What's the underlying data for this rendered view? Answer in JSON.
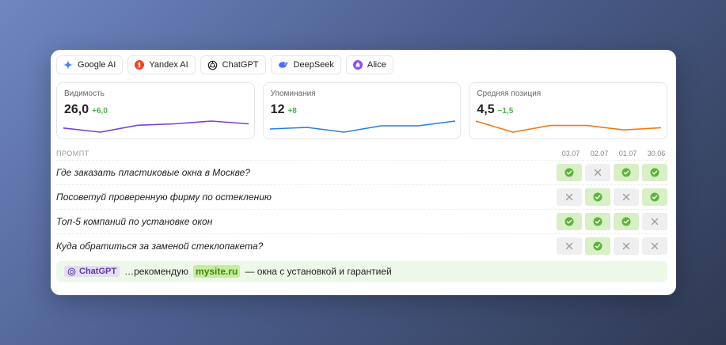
{
  "tabs": [
    {
      "label": "Google AI",
      "icon": "google-ai-icon"
    },
    {
      "label": "Yandex AI",
      "icon": "yandex-icon"
    },
    {
      "label": "ChatGPT",
      "icon": "chatgpt-icon"
    },
    {
      "label": "DeepSeek",
      "icon": "deepseek-icon"
    },
    {
      "label": "Alice",
      "icon": "alice-icon"
    }
  ],
  "stats": [
    {
      "label": "Видимость",
      "value": "26,0",
      "delta": "+6,0",
      "color": "#7b3fd6",
      "trend": [
        5,
        2,
        7,
        8,
        10,
        8
      ]
    },
    {
      "label": "Упоминания",
      "value": "12",
      "delta": "+8",
      "color": "#2a7de1",
      "trend": [
        4,
        5,
        2,
        6,
        6,
        9
      ]
    },
    {
      "label": "Средняя позиция",
      "value": "4,5",
      "delta": "−1,5",
      "color": "#f07a1a",
      "trend": [
        8,
        3,
        6,
        6,
        4,
        5
      ]
    }
  ],
  "table": {
    "header": "ПРОМПТ",
    "dates": [
      "03.07",
      "02.07",
      "01.07",
      "30.06"
    ],
    "rows": [
      {
        "prompt": "Где заказать пластиковые окна в Москве?",
        "marks": [
          true,
          false,
          true,
          true
        ]
      },
      {
        "prompt": "Посоветуй проверенную фирму по остеклению",
        "marks": [
          false,
          true,
          false,
          true
        ]
      },
      {
        "prompt": "Топ-5 компаний по установке окон",
        "marks": [
          true,
          true,
          true,
          false
        ]
      },
      {
        "prompt": "Куда обратиться за заменой стеклопакета?",
        "marks": [
          false,
          true,
          false,
          false
        ]
      }
    ]
  },
  "footer": {
    "source": "ChatGPT",
    "before": "…рекомендую",
    "highlight": "mysite.ru",
    "after": "— окна с установкой и гарантией"
  },
  "colors": {
    "positive": "#4caf50",
    "accent": "#7b3fd6"
  }
}
